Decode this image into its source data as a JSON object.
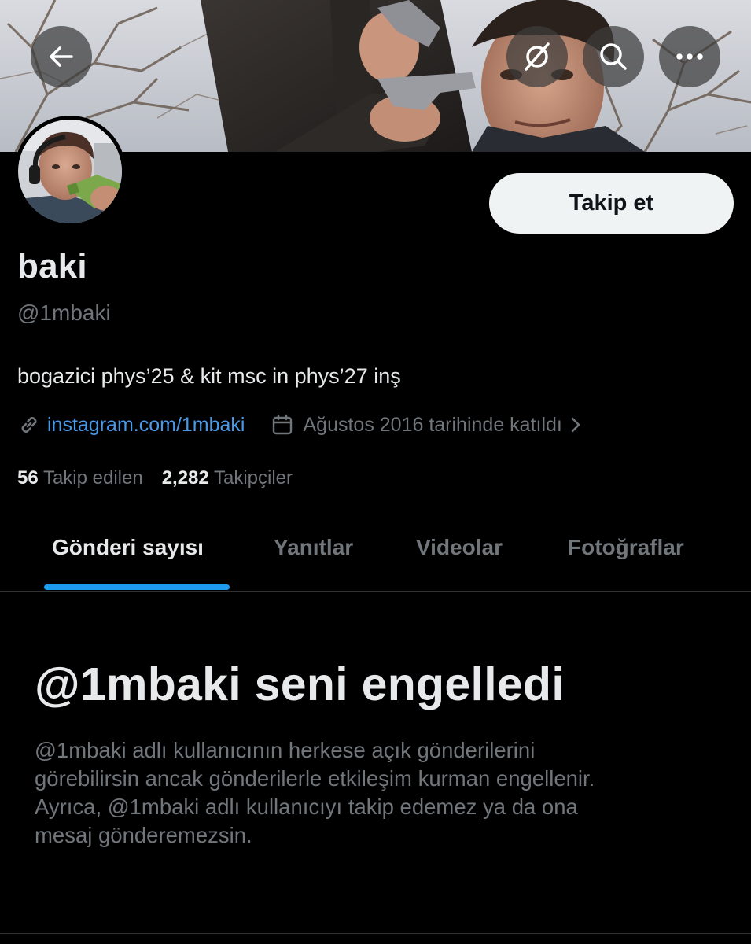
{
  "colors": {
    "background": "#000000",
    "text_primary": "#e7e9ea",
    "text_secondary": "#71767b",
    "link": "#4a99e9",
    "accent": "#1d9bf0",
    "follow_button_bg": "#eff3f4"
  },
  "header": {
    "icons": [
      "back-arrow-icon",
      "grok-icon",
      "search-icon",
      "more-icon"
    ]
  },
  "profile": {
    "display_name": "baki",
    "handle": "@1mbaki",
    "bio": "bogazici phys’25 & kit msc in phys’27 inş",
    "link": "instagram.com/1mbaki",
    "joined": "Ağustos 2016 tarihinde katıldı",
    "following_count": "56",
    "following_label": "Takip edilen",
    "followers_count": "2,282",
    "followers_label": "Takipçiler",
    "follow_label": "Takip et"
  },
  "tabs": [
    {
      "label": "Gönderi sayısı",
      "active": true
    },
    {
      "label": "Yanıtlar",
      "active": false
    },
    {
      "label": "Videolar",
      "active": false
    },
    {
      "label": "Fotoğraflar",
      "active": false
    }
  ],
  "blocked": {
    "title": "@1mbaki seni engelledi",
    "lines": [
      "@1mbaki adlı kullanıcının herkese açık gönderilerini",
      "görebilirsin ancak gönderilerle etkileşim kurman engellenir.",
      "Ayrıca, @1mbaki adlı kullanıcıyı takip edemez ya da ona",
      "mesaj gönderemezsin."
    ]
  }
}
